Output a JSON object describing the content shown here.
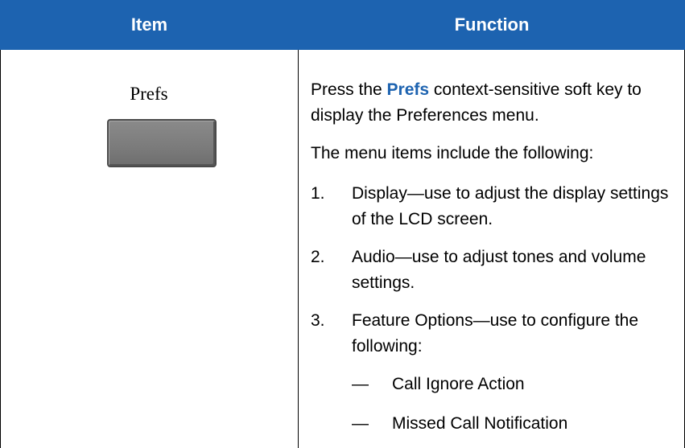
{
  "header": {
    "item": "Item",
    "function": "Function"
  },
  "row": {
    "item_name": "Prefs",
    "softkey_icon": "soft-key-button",
    "intro": {
      "before": "Press the ",
      "highlight": "Prefs",
      "after": " context-sensitive soft key to display the Preferences menu."
    },
    "lead": "The menu items include the following:",
    "items": [
      {
        "num": "1.",
        "text": "Display—use to adjust the display settings of the LCD screen."
      },
      {
        "num": "2.",
        "text": "Audio—use to adjust tones and volume settings."
      },
      {
        "num": "3.",
        "text": "Feature Options—use to configure the following:"
      }
    ],
    "subitems": [
      {
        "dash": "—",
        "text": "Call Ignore Action"
      },
      {
        "dash": "—",
        "text": "Missed Call Notification"
      }
    ]
  },
  "colors": {
    "header_bg": "#1d63b0",
    "highlight": "#1d63b0"
  }
}
